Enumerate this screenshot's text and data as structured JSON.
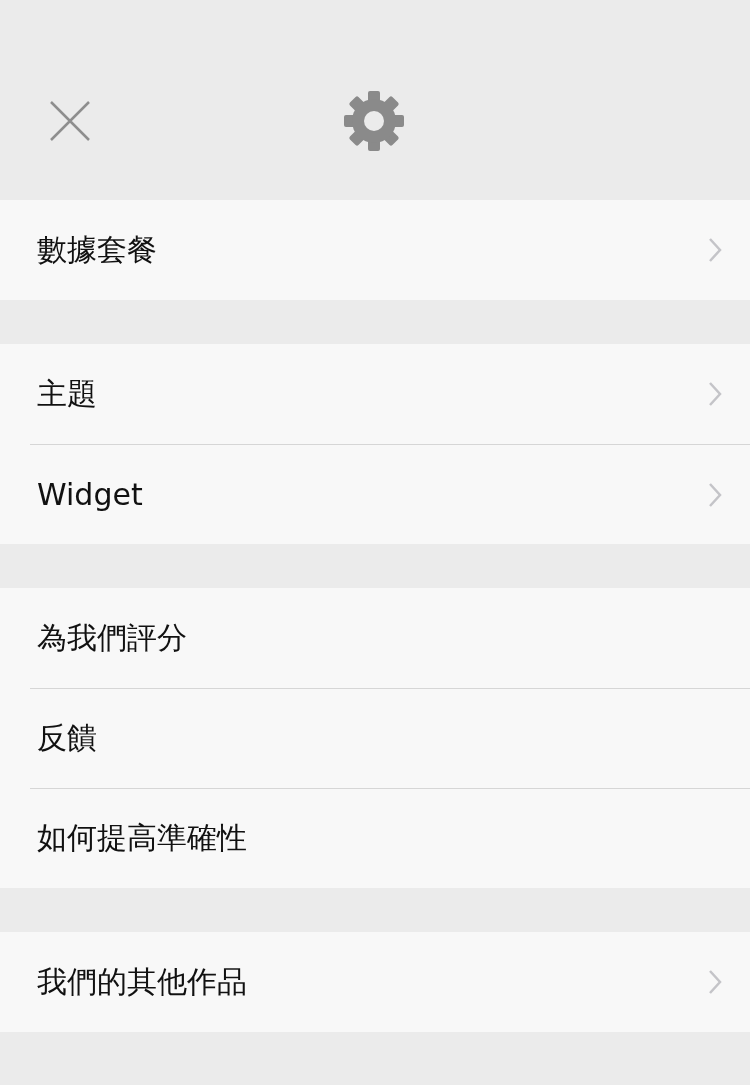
{
  "sections": [
    {
      "items": [
        {
          "label": "數據套餐",
          "chevron": true
        }
      ]
    },
    {
      "items": [
        {
          "label": "主題",
          "chevron": true
        },
        {
          "label": "Widget",
          "chevron": true
        }
      ]
    },
    {
      "items": [
        {
          "label": "為我們評分",
          "chevron": false
        },
        {
          "label": "反饋",
          "chevron": false
        },
        {
          "label": "如何提高準確性",
          "chevron": false
        }
      ]
    },
    {
      "items": [
        {
          "label": "我們的其他作品",
          "chevron": true
        }
      ]
    }
  ]
}
